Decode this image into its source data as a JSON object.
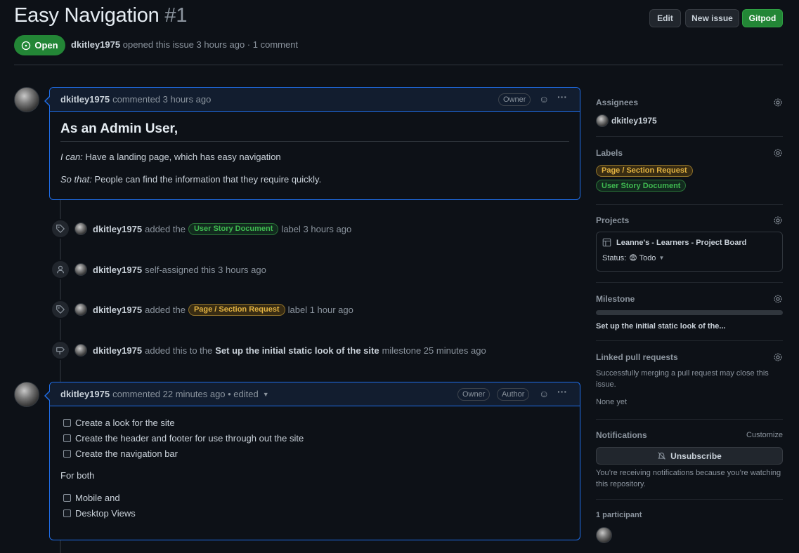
{
  "issue": {
    "title": "Easy Navigation",
    "number": "#1",
    "state": "Open",
    "author": "dkitley1975",
    "meta_text": "opened this issue 3 hours ago · 1 comment"
  },
  "actions": {
    "edit": "Edit",
    "new_issue": "New issue",
    "gitpod": "Gitpod"
  },
  "comment1": {
    "author": "dkitley1975",
    "time": "commented 3 hours ago",
    "role": "Owner",
    "heading": "As an Admin User,",
    "line1_label": "I can:",
    "line1_text": " Have a landing page, which has easy navigation",
    "line2_label": "So that:",
    "line2_text": " People can find the information that they require quickly."
  },
  "events": [
    {
      "user": "dkitley1975",
      "pre": "added the",
      "label": "User Story Document",
      "post": "label 3 hours ago"
    },
    {
      "user": "dkitley1975",
      "pre": "self-assigned this 3 hours ago"
    },
    {
      "user": "dkitley1975",
      "pre": "added the",
      "label": "Page / Section Request",
      "post": "label 1 hour ago"
    },
    {
      "user": "dkitley1975",
      "pre": "added this to the",
      "bold": "Set up the initial static look of the site",
      "post": "milestone 25 minutes ago"
    }
  ],
  "comment2": {
    "author": "dkitley1975",
    "time": "commented 22 minutes ago • edited",
    "role1": "Owner",
    "role2": "Author",
    "tasks_a": [
      "Create a look for the site",
      "Create the header and footer for use through out the site",
      "Create the navigation bar"
    ],
    "para": "For both",
    "tasks_b": [
      "Mobile and",
      "Desktop Views"
    ]
  },
  "sidebar": {
    "assignees_title": "Assignees",
    "assignee": "dkitley1975",
    "labels_title": "Labels",
    "labels": [
      "Page / Section Request",
      "User Story Document"
    ],
    "projects_title": "Projects",
    "project_name": "Leanne's - Learners - Project Board",
    "project_status_label": "Status:",
    "project_status": "😨 Todo",
    "milestone_title": "Milestone",
    "milestone_progress": 0,
    "milestone_name": "Set up the initial static look of the...",
    "linked_title": "Linked pull requests",
    "linked_text": "Successfully merging a pull request may close this issue.",
    "linked_none": "None yet",
    "notifications_title": "Notifications",
    "customize": "Customize",
    "unsubscribe": "Unsubscribe",
    "notif_text": "You’re receiving notifications because you’re watching this repository.",
    "participants": "1 participant"
  },
  "colors": {
    "background": "#0d1117",
    "green": "#238636",
    "accent_blue": "#1f6feb",
    "label_green": "#3fb950",
    "label_yellow": "#e3b341"
  }
}
